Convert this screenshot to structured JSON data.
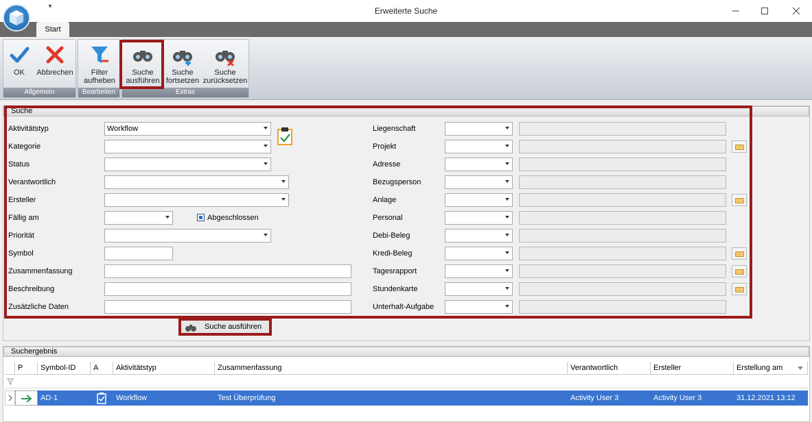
{
  "window": {
    "title": "Erweiterte Suche"
  },
  "ribbon": {
    "tab": "Start",
    "groups": {
      "allgemein": "Allgemein",
      "bearbeiten": "Bearbeiten",
      "extras": "Extras"
    },
    "buttons": {
      "ok": "OK",
      "abbrechen": "Abbrechen",
      "filter_1": "Filter",
      "filter_2": "aufheben",
      "run_1": "Suche",
      "run_2": "ausführen",
      "cont_1": "Suche",
      "cont_2": "fortsetzen",
      "reset_1": "Suche",
      "reset_2": "zurücksetzen"
    }
  },
  "search": {
    "title": "Suche",
    "labels": {
      "aktivitaetstyp": "Aktivitätstyp",
      "kategorie": "Kategorie",
      "status": "Status",
      "verantwortlich": "Verantwortlich",
      "ersteller": "Ersteller",
      "faellig": "Fällig am",
      "prioritaet": "Priorität",
      "symbol": "Symbol",
      "zusammenfassung": "Zusammenfassung",
      "beschreibung": "Beschreibung",
      "zusaetzlich": "Zusätzliche Daten",
      "abgeschlossen": "Abgeschlossen"
    },
    "values": {
      "aktivitaetstyp": "Workflow"
    },
    "right_labels": {
      "liegenschaft": "Liegenschaft",
      "projekt": "Projekt",
      "adresse": "Adresse",
      "bezugsperson": "Bezugsperson",
      "anlage": "Anlage",
      "personal": "Personal",
      "debi": "Debi-Beleg",
      "kredi": "Kredi-Beleg",
      "tagesrapport": "Tagesrapport",
      "stundenkarte": "Stundenkarte",
      "unterhalt": "Unterhalt-Aufgabe"
    },
    "run_button": "Suche ausführen"
  },
  "results": {
    "title": "Suchergebnis",
    "columns": {
      "p": "P",
      "symbol_id": "Symbol-ID",
      "a": "A",
      "typ": "Aktivitätstyp",
      "zusammenfassung": "Zusammenfassung",
      "verantwortlich": "Verantwortlich",
      "ersteller": "Ersteller",
      "erstellt": "Erstellung am"
    },
    "row": {
      "symbol_id": "AD-1",
      "typ": "Workflow",
      "zusammenfassung": "Test Überprüfung",
      "verantwortlich": "Activity User 3",
      "ersteller": "Activity User 3",
      "erstellt": "31.12.2021 13:12"
    }
  },
  "colors": {
    "accent_frame": "#9b1b1b",
    "selection": "#3874d0"
  }
}
